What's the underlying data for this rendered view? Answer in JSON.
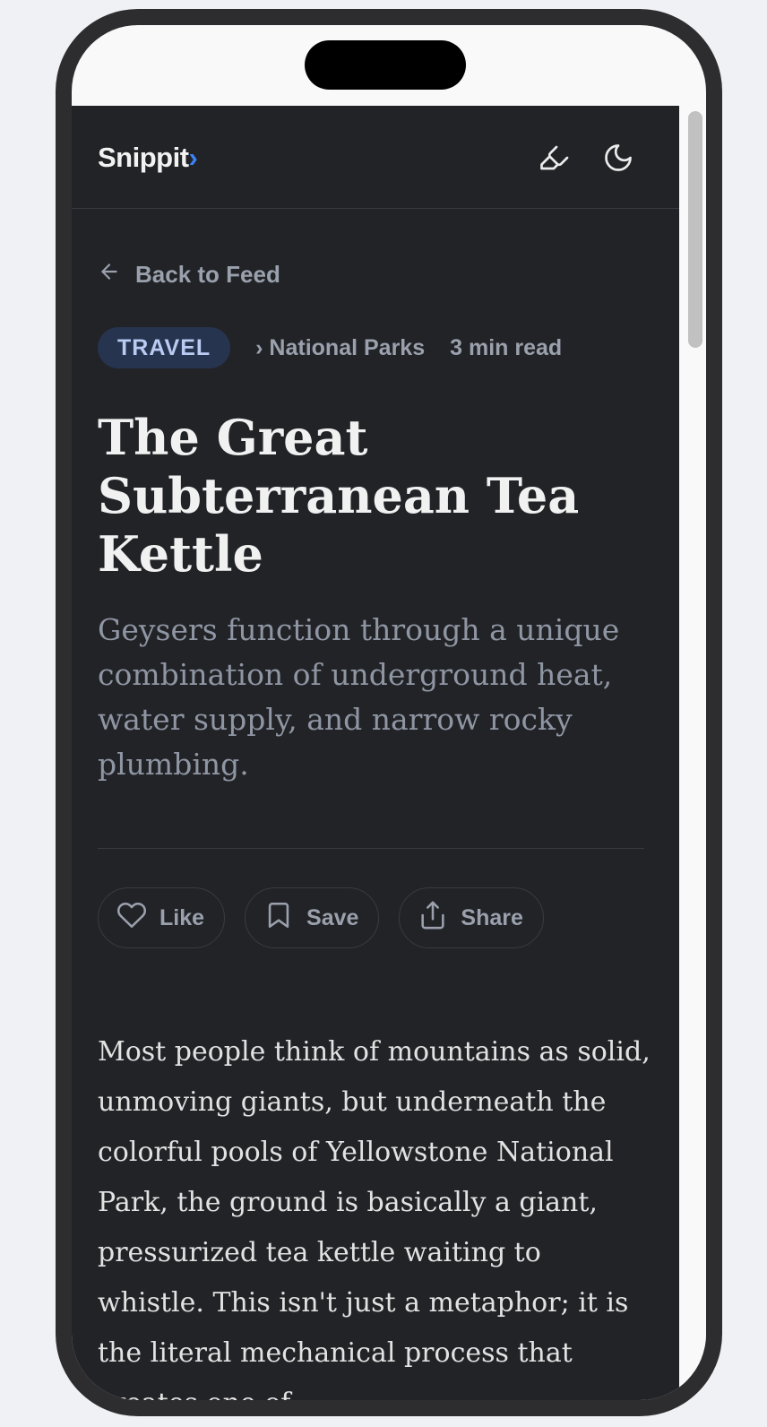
{
  "header": {
    "logo_text": "Snippit",
    "logo_accent": "›",
    "accent_color": "#3b82f6",
    "icons": [
      "highlighter-icon",
      "moon-icon"
    ]
  },
  "nav": {
    "back_label": "Back to Feed"
  },
  "article": {
    "category": "TRAVEL",
    "subcategory": "› National Parks",
    "read_time": "3 min read",
    "title": "The Great Subterranean Tea Kettle",
    "subtitle": "Geysers function through a unique combination of underground heat, water supply, and narrow rocky plumbing.",
    "body": "Most people think of mountains as solid, unmoving giants, but underneath the colorful pools of Yellowstone National Park, the ground is basically a giant, pressurized tea kettle waiting to whistle. This isn't just a metaphor; it is the literal mechanical process that creates one of"
  },
  "actions": {
    "like_label": "Like",
    "save_label": "Save",
    "share_label": "Share"
  }
}
